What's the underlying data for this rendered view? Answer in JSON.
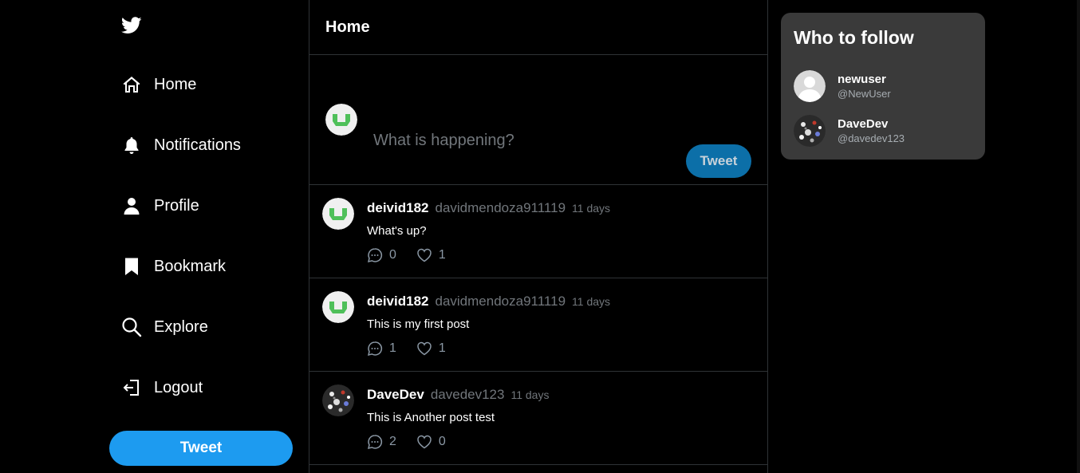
{
  "colors": {
    "accent": "#1d9bf0",
    "accent_dim": "#0c6fa8",
    "card_bg": "#3a3a3a",
    "muted": "#71767b"
  },
  "sidebar": {
    "logo_icon": "twitter-bird-icon",
    "items": [
      {
        "label": "Home",
        "icon": "home-icon"
      },
      {
        "label": "Notifications",
        "icon": "bell-icon"
      },
      {
        "label": "Profile",
        "icon": "person-icon"
      },
      {
        "label": "Bookmark",
        "icon": "bookmark-icon"
      },
      {
        "label": "Explore",
        "icon": "search-icon"
      },
      {
        "label": "Logout",
        "icon": "logout-icon"
      }
    ],
    "tweet_button": "Tweet"
  },
  "main": {
    "title": "Home",
    "composer": {
      "placeholder": "What is happening?",
      "button": "Tweet"
    },
    "posts": [
      {
        "name": "deivid182",
        "handle": "davidmendoza911119",
        "time": "11 days",
        "text": "What's up?",
        "comments": "0",
        "likes": "1"
      },
      {
        "name": "deivid182",
        "handle": "davidmendoza911119",
        "time": "11 days",
        "text": "This is my first post",
        "comments": "1",
        "likes": "1"
      },
      {
        "name": "DaveDev",
        "handle": "davedev123",
        "time": "11 days",
        "text": "This is Another post test",
        "comments": "2",
        "likes": "0"
      }
    ]
  },
  "right": {
    "title": "Who to follow",
    "users": [
      {
        "name": "newuser",
        "handle": "@NewUser"
      },
      {
        "name": "DaveDev",
        "handle": "@davedev123"
      }
    ]
  }
}
